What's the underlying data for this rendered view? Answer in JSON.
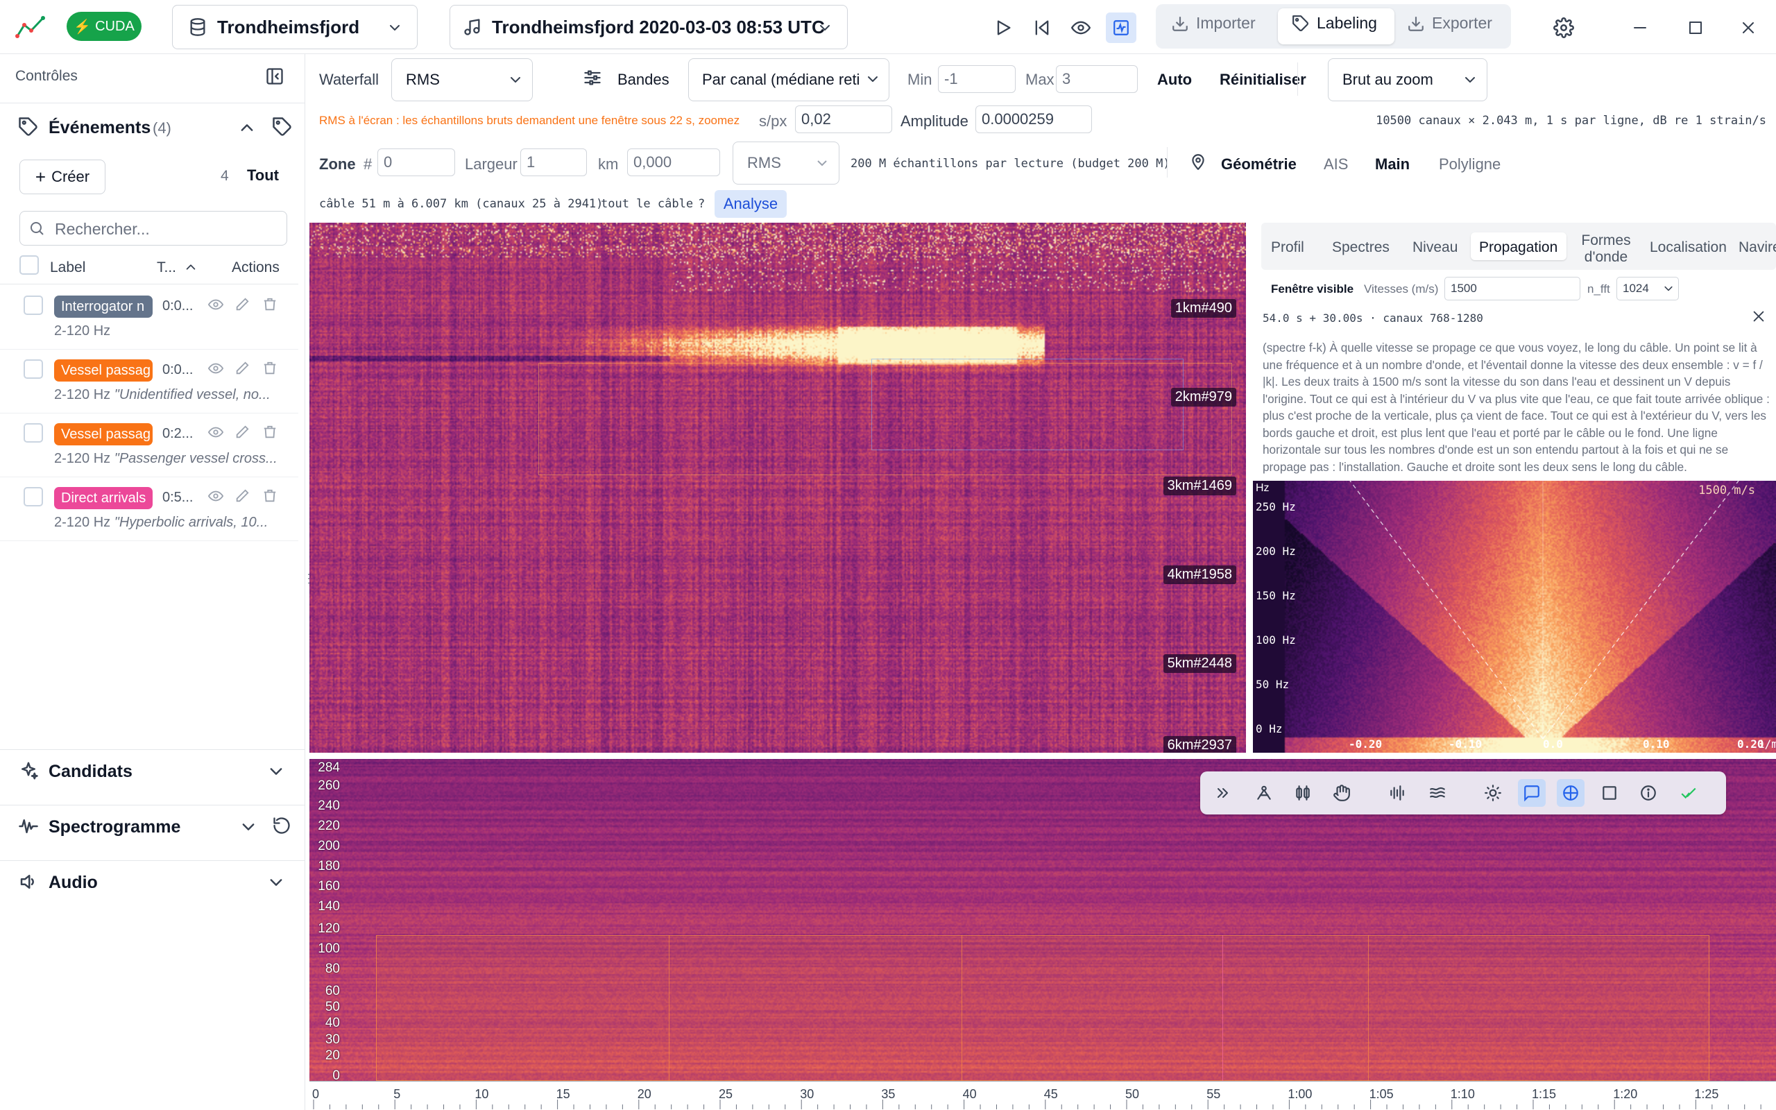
{
  "titlebar": {
    "cuda_badge": "CUDA",
    "dataset": "Trondheimsfjord",
    "recording": "Trondheimsfjord 2020-03-03 08:53 UTC",
    "modes": {
      "import": "Importer",
      "labeling": "Labeling",
      "export": "Exporter"
    },
    "accent": "#1f9d55"
  },
  "sidebar": {
    "header": "Contrôles",
    "events": {
      "title": "Événements",
      "count": "(4)",
      "create": "Créer",
      "total": "4",
      "all": "Tout",
      "search_placeholder": "Rechercher...",
      "columns": {
        "label": "Label",
        "type": "T...",
        "actions": "Actions"
      },
      "rows": [
        {
          "label": "Interrogator n",
          "time": "0:0...",
          "freq": "2-120 Hz",
          "note": "",
          "color": "#64748b"
        },
        {
          "label": "Vessel passag",
          "time": "0:0...",
          "freq": "2-120 Hz",
          "note": "\"Unidentified vessel, no...",
          "color": "#f97316"
        },
        {
          "label": "Vessel passag",
          "time": "0:2...",
          "freq": "2-120 Hz",
          "note": "\"Passenger vessel cross...",
          "color": "#f97316"
        },
        {
          "label": "Direct arrivals",
          "time": "0:5...",
          "freq": "2-120 Hz",
          "note": "\"Hyperbolic arrivals, 10...",
          "color": "#ec4899"
        }
      ]
    },
    "candidates": "Candidats",
    "spectrogram": "Spectrogramme",
    "audio": "Audio"
  },
  "controls": {
    "row1": {
      "waterfall": "Waterfall",
      "mode": "RMS",
      "bands": "Bandes",
      "normalize": "Par canal (médiane reti",
      "min_label": "Min",
      "min_value": "-1",
      "max_label": "Max",
      "max_value": "3",
      "auto": "Auto",
      "reset": "Réinitialiser",
      "zoom_mode": "Brut au zoom"
    },
    "row2": {
      "warning": "RMS à l'écran : les échantillons bruts demandent une fenêtre sous 22 s, zoomez",
      "spx_label": "s/px",
      "spx_value": "0,02",
      "amp_label": "Amplitude",
      "amp_value": "0.0000259",
      "info": "10500 canaux × 2.043 m, 1 s par ligne, dB re 1 strain/s"
    },
    "row3": {
      "zone_label": "Zone",
      "hash": "#",
      "zone_value": "0",
      "width_label": "Largeur",
      "width_value": "1",
      "km_label": "km",
      "km_value": "0,000",
      "agg": "RMS",
      "budget": "200 M échantillons par lecture (budget 200 M)",
      "geometry": "Géométrie",
      "ais": "AIS",
      "hand": "Main",
      "polyline": "Polyligne"
    },
    "row4": {
      "cable": "câble 51 m à 6.007 km (canaux 25 à 2941)",
      "whole": "tout le câble",
      "q": "?",
      "analysis": "Analyse"
    }
  },
  "waterfall": {
    "distances": [
      "1km#490",
      "2km#979",
      "3km#1469",
      "4km#1958",
      "5km#2448",
      "6km#2937"
    ]
  },
  "analysis_panel": {
    "tabs": [
      "Profil",
      "Spectres",
      "Niveau",
      "Propagation",
      "Formes d'onde",
      "Localisation",
      "Navire"
    ],
    "active_tab": "Propagation",
    "visible_window": "Fenêtre visible",
    "speeds_label": "Vitesses (m/s)",
    "speeds_value": "1500",
    "nfft_label": "n_fft",
    "nfft_value": "1024",
    "window_info": "54.0 s + 30.00s · canaux 768-1280",
    "description": "(spectre f-k) À quelle vitesse se propage ce que vous voyez, le long du câble. Un point se lit à une fréquence et à un nombre d'onde, et l'éventail donne la vitesse des deux ensemble : v = f / |k|. Les deux traits à 1500 m/s sont la vitesse du son dans l'eau et dessinent un V depuis l'origine. Tout ce qui est à l'intérieur du V va plus vite que l'eau, ce que fait toute arrivée oblique : plus c'est proche de la verticale, plus ça vient de face. Tout ce qui est à l'extérieur du V, vers les bords gauche et droit, est plus lent que l'eau et porté par le câble ou le fond. Une ligne horizontale sur tous les nombres d'onde est un son entendu partout à la fois et qui ne se propage pas : l'installation. Gauche et droite sont les deux sens le long du câble.",
    "fk": {
      "unit": "Hz",
      "y_ticks": [
        "250 Hz",
        "200 Hz",
        "150 Hz",
        "100 Hz",
        "50 Hz",
        "0 Hz"
      ],
      "x_ticks": [
        "-0.20",
        "-0.10",
        "0.0",
        "0.10",
        "0.20"
      ],
      "x_unit": "1/m",
      "speed_label": "1500 m/s"
    }
  },
  "spectrogram": {
    "y_ticks": [
      "284",
      "260",
      "240",
      "220",
      "200",
      "180",
      "160",
      "140",
      "120",
      "100",
      "80",
      "60",
      "50",
      "40",
      "30",
      "20",
      "0"
    ],
    "time_ticks": [
      "0",
      "5",
      "10",
      "15",
      "20",
      "25",
      "30",
      "35",
      "40",
      "45",
      "50",
      "55",
      "1:00",
      "1:05",
      "1:10",
      "1:15",
      "1:20",
      "1:25"
    ]
  },
  "toolbar_icons": [
    "double-chevron-icon",
    "node-icon",
    "columns-icon",
    "hand-icon",
    "waveform-icon",
    "lines-icon",
    "sun-icon",
    "comment-icon",
    "crosshair-icon",
    "square-icon",
    "info-icon",
    "check-icon"
  ]
}
